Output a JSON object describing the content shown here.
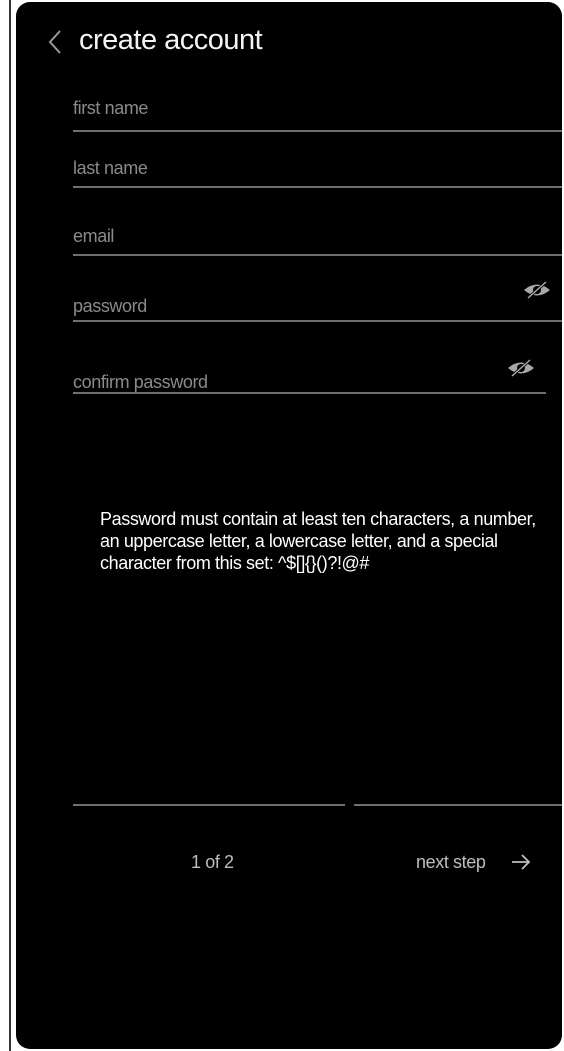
{
  "header": {
    "title": "create account",
    "back_icon": "chevron-left-icon"
  },
  "form": {
    "first_name": {
      "label": "first name",
      "value": ""
    },
    "last_name": {
      "label": "last name",
      "value": ""
    },
    "email": {
      "label": "email",
      "value": ""
    },
    "password": {
      "label": "password",
      "value": "",
      "visibility_icon": "eye-off-icon"
    },
    "confirm_password": {
      "label": "confirm password",
      "value": "",
      "visibility_icon": "eye-off-icon"
    }
  },
  "requirements_text": "Password must contain at least ten characters, a number, an uppercase letter, a lowercase letter, and a special character from this set: ^$[]{}()?!@#",
  "footer": {
    "step_indicator": "1 of 2",
    "next_label": "next step",
    "next_icon": "arrow-right-icon"
  },
  "colors": {
    "background": "#000000",
    "text": "#f2f2f2",
    "muted_text": "#8a8a8a",
    "divider": "#6f6f6f"
  }
}
